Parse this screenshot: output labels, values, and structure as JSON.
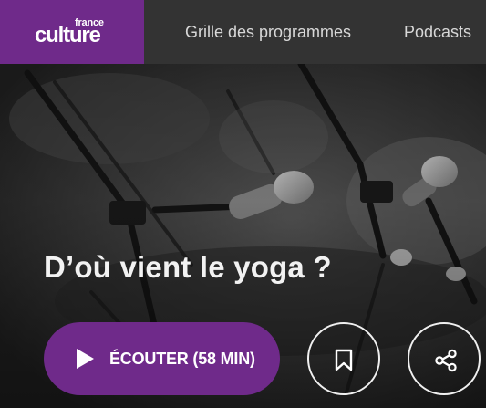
{
  "header": {
    "logo": {
      "line1": "france",
      "line2": "culture",
      "color": "#6f2a8a"
    },
    "nav": [
      {
        "label": "Grille des programmes"
      },
      {
        "label": "Podcasts"
      }
    ]
  },
  "episode": {
    "title": "D’où vient le yoga ?",
    "listen_button": {
      "label": "ÉCOUTER (58 MIN)",
      "icon": "play-icon"
    },
    "bookmark_button": {
      "icon": "bookmark-icon"
    },
    "share_button": {
      "icon": "share-icon"
    }
  },
  "colors": {
    "brand_purple": "#6f2a8a",
    "header_bg": "#333333",
    "nav_text": "#d8d8d8"
  }
}
